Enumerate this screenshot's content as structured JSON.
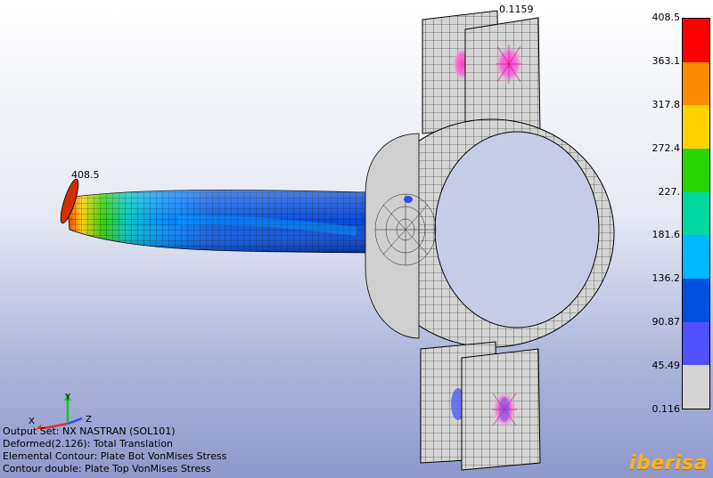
{
  "labels": {
    "max": "408.5",
    "min": "0.1159"
  },
  "info": {
    "line1": "Output Set: NX NASTRAN (SOL101)",
    "line2": "Deformed(2.126): Total Translation",
    "line3": "Elemental Contour: Plate Bot VonMises Stress",
    "line4": "Contour double: Plate Top VonMises Stress"
  },
  "axes": {
    "x": "X",
    "y": "Y",
    "z": "Z"
  },
  "legend": {
    "ticks": [
      "408.5",
      "363.1",
      "317.8",
      "272.4",
      "227.",
      "181.6",
      "136.2",
      "90.87",
      "45.49",
      "0.116"
    ],
    "colors": [
      "#ff0000",
      "#ff8c00",
      "#ffd200",
      "#27d600",
      "#00d8a0",
      "#00b8ff",
      "#0050e0",
      "#5050ff",
      "#d4d4d4"
    ]
  },
  "brand": "iberisa",
  "colors": {
    "mesh": "#d0d0d0",
    "mesh_line": "#202020"
  }
}
